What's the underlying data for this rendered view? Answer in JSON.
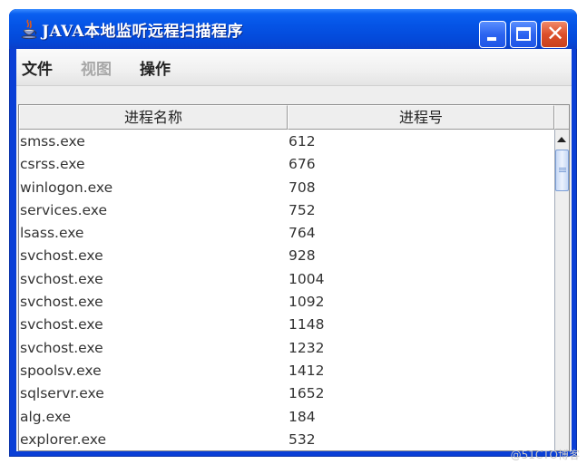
{
  "window": {
    "title": "JAVA本地监听远程扫描程序",
    "icon": "java-coffee-cup-icon",
    "controls": {
      "minimize": "minimize",
      "maximize": "maximize",
      "close": "✕"
    }
  },
  "menubar": {
    "items": [
      {
        "label": "文件",
        "enabled": true
      },
      {
        "label": "视图",
        "enabled": false
      },
      {
        "label": "操作",
        "enabled": true
      }
    ]
  },
  "table": {
    "columns": [
      "进程名称",
      "进程号"
    ],
    "rows": [
      [
        "smss.exe",
        "612"
      ],
      [
        "csrss.exe",
        "676"
      ],
      [
        "winlogon.exe",
        "708"
      ],
      [
        "services.exe",
        "752"
      ],
      [
        "lsass.exe",
        "764"
      ],
      [
        "svchost.exe",
        "928"
      ],
      [
        "svchost.exe",
        "1004"
      ],
      [
        "svchost.exe",
        "1092"
      ],
      [
        "svchost.exe",
        "1148"
      ],
      [
        "svchost.exe",
        "1232"
      ],
      [
        "spoolsv.exe",
        "1412"
      ],
      [
        "sqlservr.exe",
        "1652"
      ],
      [
        "alg.exe",
        "184"
      ],
      [
        "explorer.exe",
        "532"
      ]
    ]
  },
  "watermark": "@51CTO博客"
}
